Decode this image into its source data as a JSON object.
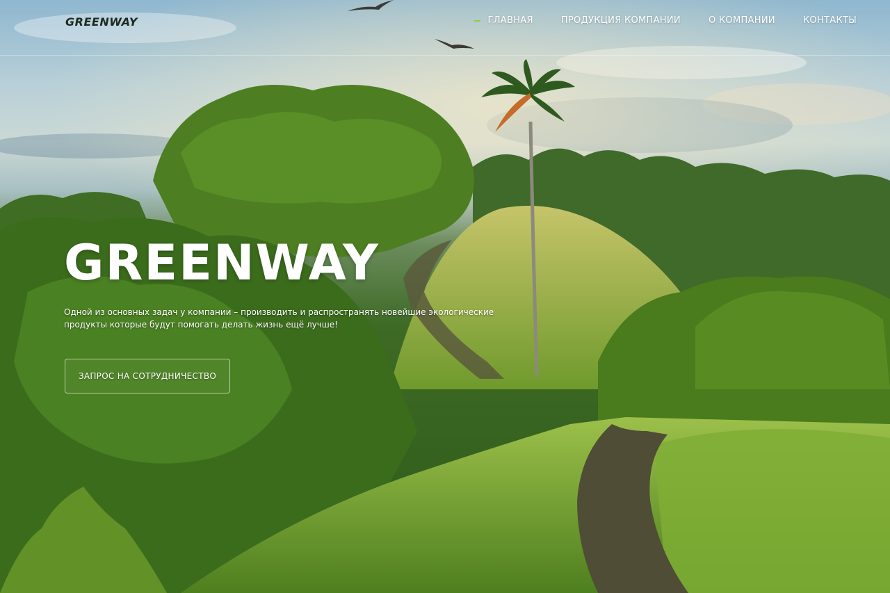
{
  "header": {
    "logo": "GREENWAY",
    "nav": [
      {
        "label": "ГЛАВНАЯ",
        "active": true
      },
      {
        "label": "ПРОДУКЦИЯ КОМПАНИИ",
        "active": false
      },
      {
        "label": "О КОМПАНИИ",
        "active": false
      },
      {
        "label": "КОНТАКТЫ",
        "active": false
      }
    ]
  },
  "hero": {
    "title": "GREENWAY",
    "text": "Одной из основных задач у компании – производить и распространять новейшие экологические продукты которые будут помогать делать жизнь ещё лучше!",
    "cta_label": "ЗАПРОС НА СОТРУДНИЧЕСТВО"
  },
  "colors": {
    "accent": "#8ad13a",
    "text": "#ffffff",
    "logo": "#1f2a1e"
  }
}
